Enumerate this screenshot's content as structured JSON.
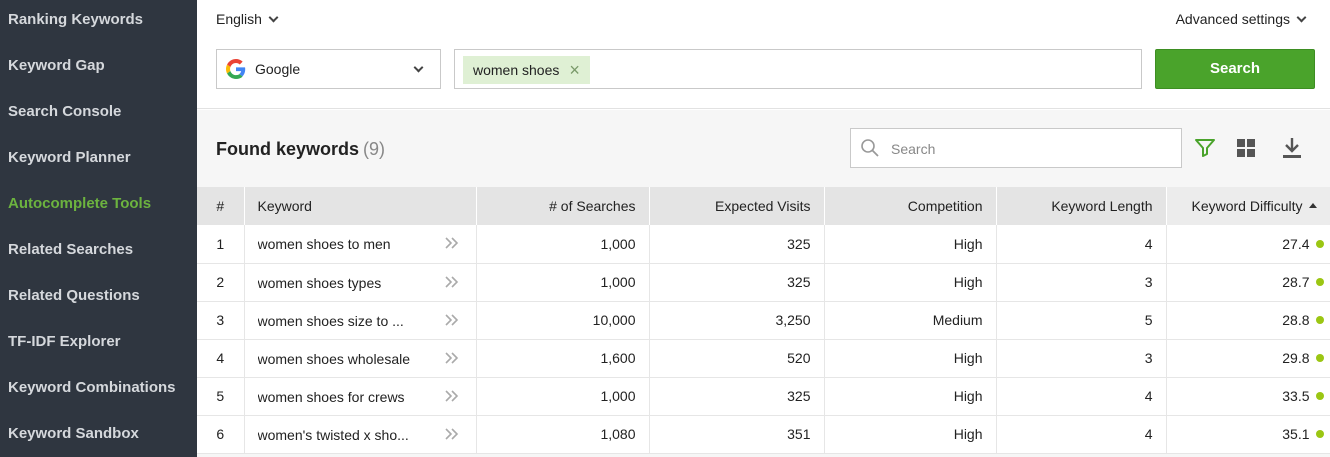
{
  "colors": {
    "sidebar_bg": "#2f3640",
    "active": "#6cb33f",
    "primary_button": "#4aa32b",
    "tag_bg": "#dff0d4",
    "difficulty_dot": "#9bc613"
  },
  "sidebar": {
    "items": [
      {
        "label": "Ranking Keywords",
        "active": false
      },
      {
        "label": "Keyword Gap",
        "active": false
      },
      {
        "label": "Search Console",
        "active": false
      },
      {
        "label": "Keyword Planner",
        "active": false
      },
      {
        "label": "Autocomplete Tools",
        "active": true
      },
      {
        "label": "Related Searches",
        "active": false
      },
      {
        "label": "Related Questions",
        "active": false
      },
      {
        "label": "TF-IDF Explorer",
        "active": false
      },
      {
        "label": "Keyword Combinations",
        "active": false
      },
      {
        "label": "Keyword Sandbox",
        "active": false
      }
    ]
  },
  "topbar": {
    "language": "English",
    "advanced": "Advanced settings",
    "engine": {
      "label": "Google",
      "icon": "google-icon"
    },
    "query_tag": "women shoes",
    "search_button": "Search"
  },
  "results": {
    "title": "Found keywords",
    "count": "(9)",
    "search_placeholder": "Search",
    "icons": [
      "filter-icon",
      "grid-view-icon",
      "download-icon"
    ]
  },
  "table": {
    "columns": {
      "num": "#",
      "keyword": "Keyword",
      "searches": "# of Searches",
      "visits": "Expected Visits",
      "competition": "Competition",
      "length": "Keyword Length",
      "difficulty": "Keyword Difficulty"
    },
    "rows": [
      {
        "num": "1",
        "keyword": "women shoes to men",
        "searches": "1,000",
        "visits": "325",
        "competition": "High",
        "length": "4",
        "difficulty": "27.4"
      },
      {
        "num": "2",
        "keyword": "women shoes types",
        "searches": "1,000",
        "visits": "325",
        "competition": "High",
        "length": "3",
        "difficulty": "28.7"
      },
      {
        "num": "3",
        "keyword": "women shoes size to ...",
        "searches": "10,000",
        "visits": "3,250",
        "competition": "Medium",
        "length": "5",
        "difficulty": "28.8"
      },
      {
        "num": "4",
        "keyword": "women shoes wholesale",
        "searches": "1,600",
        "visits": "520",
        "competition": "High",
        "length": "3",
        "difficulty": "29.8"
      },
      {
        "num": "5",
        "keyword": "women shoes for crews",
        "searches": "1,000",
        "visits": "325",
        "competition": "High",
        "length": "4",
        "difficulty": "33.5"
      },
      {
        "num": "6",
        "keyword": "women's twisted x sho...",
        "searches": "1,080",
        "visits": "351",
        "competition": "High",
        "length": "4",
        "difficulty": "35.1"
      }
    ]
  }
}
